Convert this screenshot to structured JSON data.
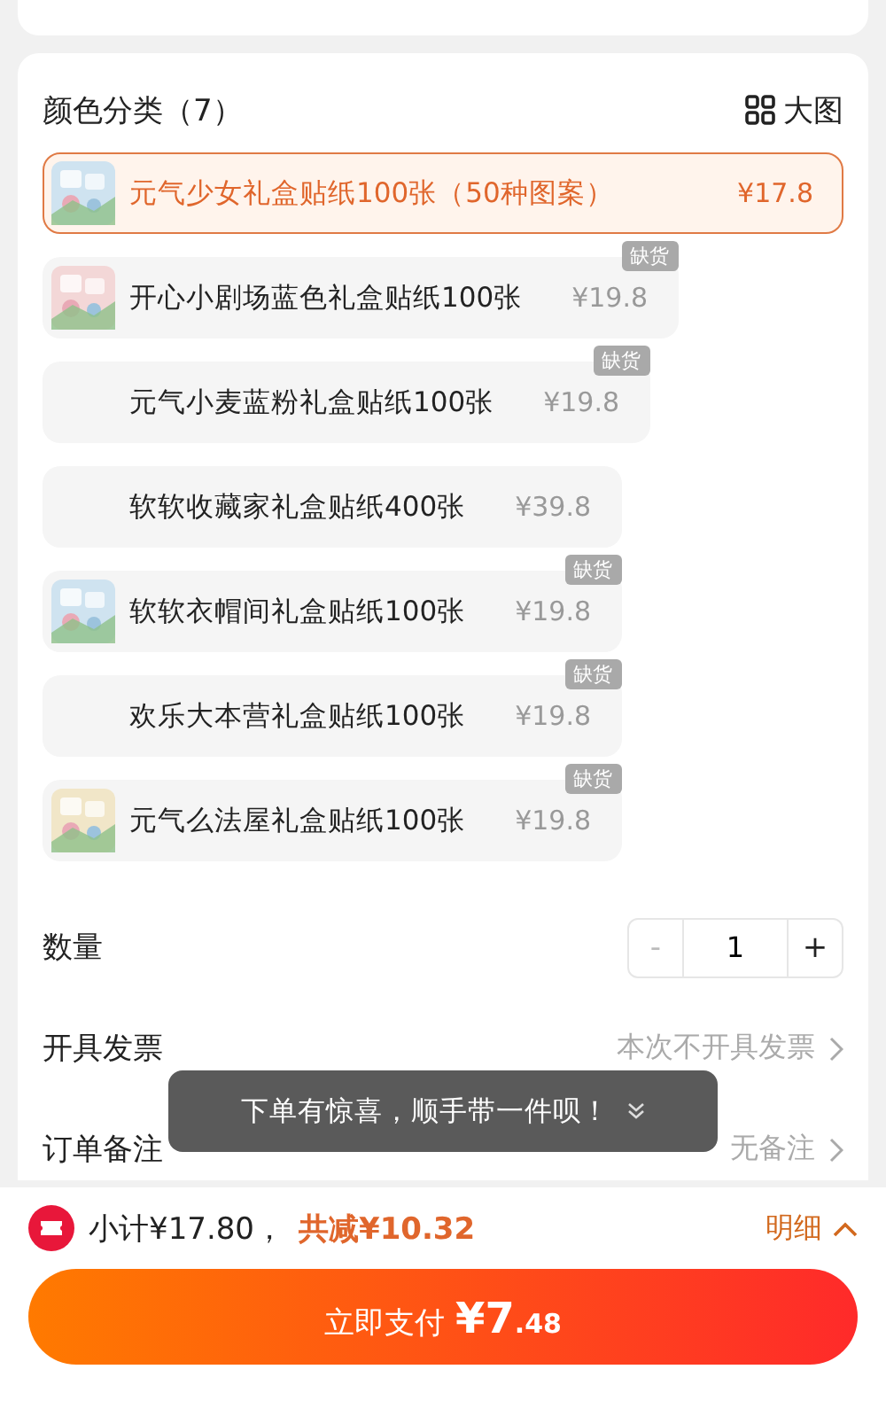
{
  "options_section": {
    "title": "颜色分类（7）",
    "view_toggle": "大图"
  },
  "options": [
    {
      "name": "元气少女礼盒贴纸100张（50种图案）",
      "price": "¥17.8",
      "selected": true,
      "has_image": true
    },
    {
      "name": "开心小剧场蓝色礼盒贴纸100张",
      "price": "¥19.8",
      "selected": false,
      "has_image": true,
      "badge": "缺货"
    },
    {
      "name": "元气小麦蓝粉礼盒贴纸100张",
      "price": "¥19.8",
      "selected": false,
      "has_image": false,
      "badge": "缺货"
    },
    {
      "name": "软软收藏家礼盒贴纸400张",
      "price": "¥39.8",
      "selected": false,
      "has_image": false
    },
    {
      "name": "软软衣帽间礼盒贴纸100张",
      "price": "¥19.8",
      "selected": false,
      "has_image": true,
      "badge": "缺货"
    },
    {
      "name": "欢乐大本营礼盒贴纸100张",
      "price": "¥19.8",
      "selected": false,
      "has_image": false,
      "badge": "缺货"
    },
    {
      "name": "元气么法屋礼盒贴纸100张",
      "price": "¥19.8",
      "selected": false,
      "has_image": true,
      "badge": "缺货"
    }
  ],
  "quantity": {
    "label": "数量",
    "minus": "-",
    "value": "1",
    "plus": "+",
    "minus_disabled": true
  },
  "rows": [
    {
      "label": "开具发票",
      "value": "本次不开具发票"
    },
    {
      "label": "订单备注",
      "value": "无备注"
    }
  ],
  "toast": {
    "text": "下单有惊喜，顺手带一件呗！"
  },
  "footer": {
    "subtotal": "小计¥17.80，",
    "discount": "共减¥10.32",
    "details": "明细"
  },
  "pay_button": {
    "label": "立即支付",
    "amount_main": "¥7",
    "amount_decimal": ".48"
  }
}
